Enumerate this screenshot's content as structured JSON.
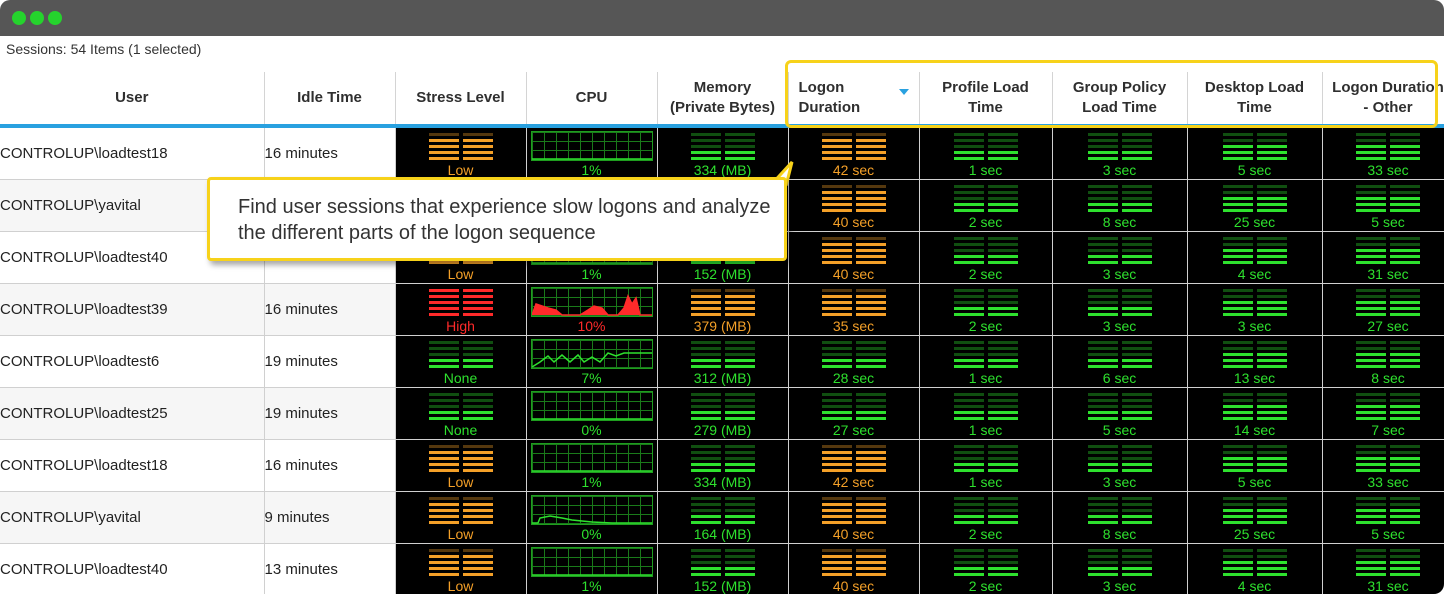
{
  "window": {
    "dots_color": "#25d32d",
    "titlebar_color": "#565656"
  },
  "summary": "Sessions: 54 Items (1 selected)",
  "columns": [
    {
      "key": "user",
      "label": "User"
    },
    {
      "key": "idle",
      "label": "Idle Time"
    },
    {
      "key": "stress",
      "label": "Stress Level"
    },
    {
      "key": "cpu",
      "label": "CPU"
    },
    {
      "key": "memory",
      "label": "Memory\n(Private Bytes)"
    },
    {
      "key": "logon",
      "label": "Logon\nDuration"
    },
    {
      "key": "profile",
      "label": "Profile Load\nTime"
    },
    {
      "key": "gp",
      "label": "Group Policy\nLoad Time"
    },
    {
      "key": "desktop",
      "label": "Desktop Load\nTime"
    },
    {
      "key": "other",
      "label": "Logon Duration\n- Other"
    }
  ],
  "callout": "Find user sessions that experience slow logons and analyze the different parts of the logon sequence",
  "colors": {
    "orange": "#f4a028",
    "green": "#2ee12e",
    "red": "#ff2a2a",
    "accent": "#29a1e0",
    "highlight": "#f7d21a"
  },
  "rows": [
    {
      "user": "CONTROLUP\\loadtest18",
      "idle": "16 minutes",
      "stress": {
        "v": "Low",
        "c": "orange"
      },
      "cpu": {
        "v": "1%",
        "c": "green"
      },
      "memory": {
        "v": "334 (MB)",
        "c": "green"
      },
      "logon": {
        "v": "42 sec",
        "c": "orange"
      },
      "profile": {
        "v": "1 sec",
        "c": "green"
      },
      "gp": {
        "v": "3 sec",
        "c": "green"
      },
      "desktop": {
        "v": "5 sec",
        "c": "green"
      },
      "other": {
        "v": "33 sec",
        "c": "green"
      }
    },
    {
      "user": "CONTROLUP\\yavital",
      "idle": "",
      "stress": {
        "v": "",
        "c": "orange"
      },
      "cpu": {
        "v": "",
        "c": "green"
      },
      "memory": {
        "v": "",
        "c": "green"
      },
      "logon": {
        "v": "40 sec",
        "c": "orange"
      },
      "profile": {
        "v": "2 sec",
        "c": "green"
      },
      "gp": {
        "v": "8 sec",
        "c": "green"
      },
      "desktop": {
        "v": "25 sec",
        "c": "green"
      },
      "other": {
        "v": "5 sec",
        "c": "green"
      }
    },
    {
      "user": "CONTROLUP\\loadtest40",
      "idle": "",
      "stress": {
        "v": "Low",
        "c": "orange"
      },
      "cpu": {
        "v": "1%",
        "c": "green"
      },
      "memory": {
        "v": "152 (MB)",
        "c": "green"
      },
      "logon": {
        "v": "40 sec",
        "c": "orange"
      },
      "profile": {
        "v": "2 sec",
        "c": "green"
      },
      "gp": {
        "v": "3 sec",
        "c": "green"
      },
      "desktop": {
        "v": "4 sec",
        "c": "green"
      },
      "other": {
        "v": "31 sec",
        "c": "green"
      }
    },
    {
      "user": "CONTROLUP\\loadtest39",
      "idle": "16 minutes",
      "stress": {
        "v": "High",
        "c": "red"
      },
      "cpu": {
        "v": "10%",
        "c": "red"
      },
      "memory": {
        "v": "379 (MB)",
        "c": "orange"
      },
      "logon": {
        "v": "35 sec",
        "c": "orange"
      },
      "profile": {
        "v": "2 sec",
        "c": "green"
      },
      "gp": {
        "v": "3 sec",
        "c": "green"
      },
      "desktop": {
        "v": "3 sec",
        "c": "green"
      },
      "other": {
        "v": "27 sec",
        "c": "green"
      }
    },
    {
      "user": "CONTROLUP\\loadtest6",
      "idle": "19 minutes",
      "stress": {
        "v": "None",
        "c": "green"
      },
      "cpu": {
        "v": "7%",
        "c": "green"
      },
      "memory": {
        "v": "312 (MB)",
        "c": "green"
      },
      "logon": {
        "v": "28 sec",
        "c": "green"
      },
      "profile": {
        "v": "1 sec",
        "c": "green"
      },
      "gp": {
        "v": "6 sec",
        "c": "green"
      },
      "desktop": {
        "v": "13 sec",
        "c": "green"
      },
      "other": {
        "v": "8 sec",
        "c": "green"
      }
    },
    {
      "user": "CONTROLUP\\loadtest25",
      "idle": "19 minutes",
      "stress": {
        "v": "None",
        "c": "green"
      },
      "cpu": {
        "v": "0%",
        "c": "green"
      },
      "memory": {
        "v": "279 (MB)",
        "c": "green"
      },
      "logon": {
        "v": "27 sec",
        "c": "green"
      },
      "profile": {
        "v": "1 sec",
        "c": "green"
      },
      "gp": {
        "v": "5 sec",
        "c": "green"
      },
      "desktop": {
        "v": "14 sec",
        "c": "green"
      },
      "other": {
        "v": "7 sec",
        "c": "green"
      }
    },
    {
      "user": "CONTROLUP\\loadtest18",
      "idle": "16 minutes",
      "stress": {
        "v": "Low",
        "c": "orange"
      },
      "cpu": {
        "v": "1%",
        "c": "green"
      },
      "memory": {
        "v": "334 (MB)",
        "c": "green"
      },
      "logon": {
        "v": "42 sec",
        "c": "orange"
      },
      "profile": {
        "v": "1 sec",
        "c": "green"
      },
      "gp": {
        "v": "3 sec",
        "c": "green"
      },
      "desktop": {
        "v": "5 sec",
        "c": "green"
      },
      "other": {
        "v": "33 sec",
        "c": "green"
      }
    },
    {
      "user": "CONTROLUP\\yavital",
      "idle": "9 minutes",
      "stress": {
        "v": "Low",
        "c": "orange"
      },
      "cpu": {
        "v": "0%",
        "c": "green"
      },
      "memory": {
        "v": "164 (MB)",
        "c": "green"
      },
      "logon": {
        "v": "40 sec",
        "c": "orange"
      },
      "profile": {
        "v": "2 sec",
        "c": "green"
      },
      "gp": {
        "v": "8 sec",
        "c": "green"
      },
      "desktop": {
        "v": "25 sec",
        "c": "green"
      },
      "other": {
        "v": "5 sec",
        "c": "green"
      }
    },
    {
      "user": "CONTROLUP\\loadtest40",
      "idle": "13 minutes",
      "stress": {
        "v": "Low",
        "c": "orange"
      },
      "cpu": {
        "v": "1%",
        "c": "green"
      },
      "memory": {
        "v": "152 (MB)",
        "c": "green"
      },
      "logon": {
        "v": "40 sec",
        "c": "orange"
      },
      "profile": {
        "v": "2 sec",
        "c": "green"
      },
      "gp": {
        "v": "3 sec",
        "c": "green"
      },
      "desktop": {
        "v": "4 sec",
        "c": "green"
      },
      "other": {
        "v": "31 sec",
        "c": "green"
      }
    }
  ]
}
